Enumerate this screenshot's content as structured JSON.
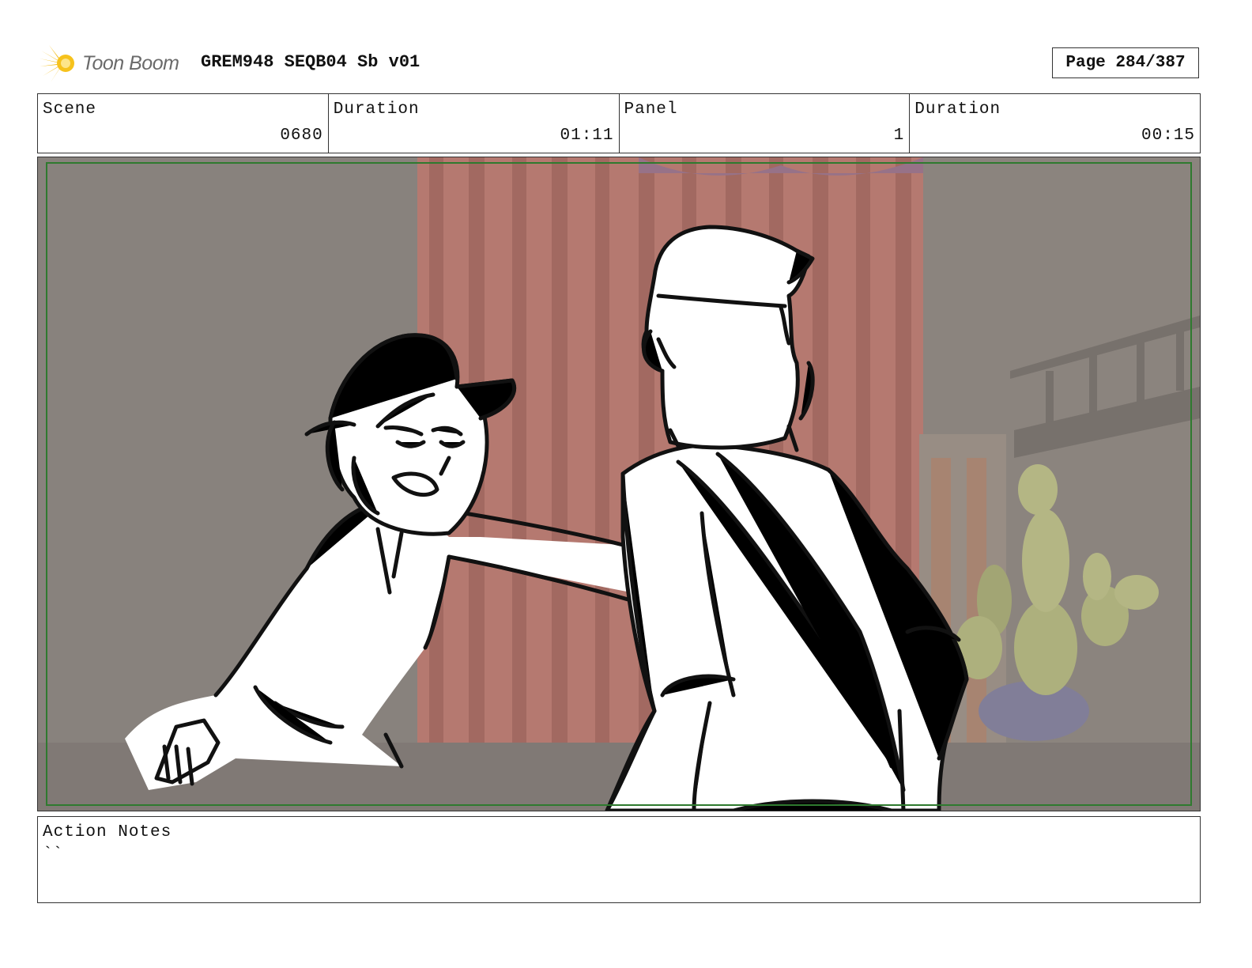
{
  "header": {
    "logo_text": "Toon Boom",
    "logo_icon": "starburst-icon",
    "title": "GREM948 SEQB04 Sb v01",
    "page": "Page 284/387"
  },
  "info": {
    "scene_label": "Scene",
    "scene_value": "0680",
    "scene_duration_label": "Duration",
    "scene_duration_value": "01:11",
    "panel_label": "Panel",
    "panel_value": "1",
    "panel_duration_label": "Duration",
    "panel_duration_value": "00:15"
  },
  "notes": {
    "label": "Action Notes",
    "text": "``"
  },
  "colors": {
    "frame_guide": "#2f7a2f",
    "curtain": "#c47468",
    "wall": "#8d8680",
    "cactus": "#b9c07a",
    "pot": "#7c7ba0"
  }
}
